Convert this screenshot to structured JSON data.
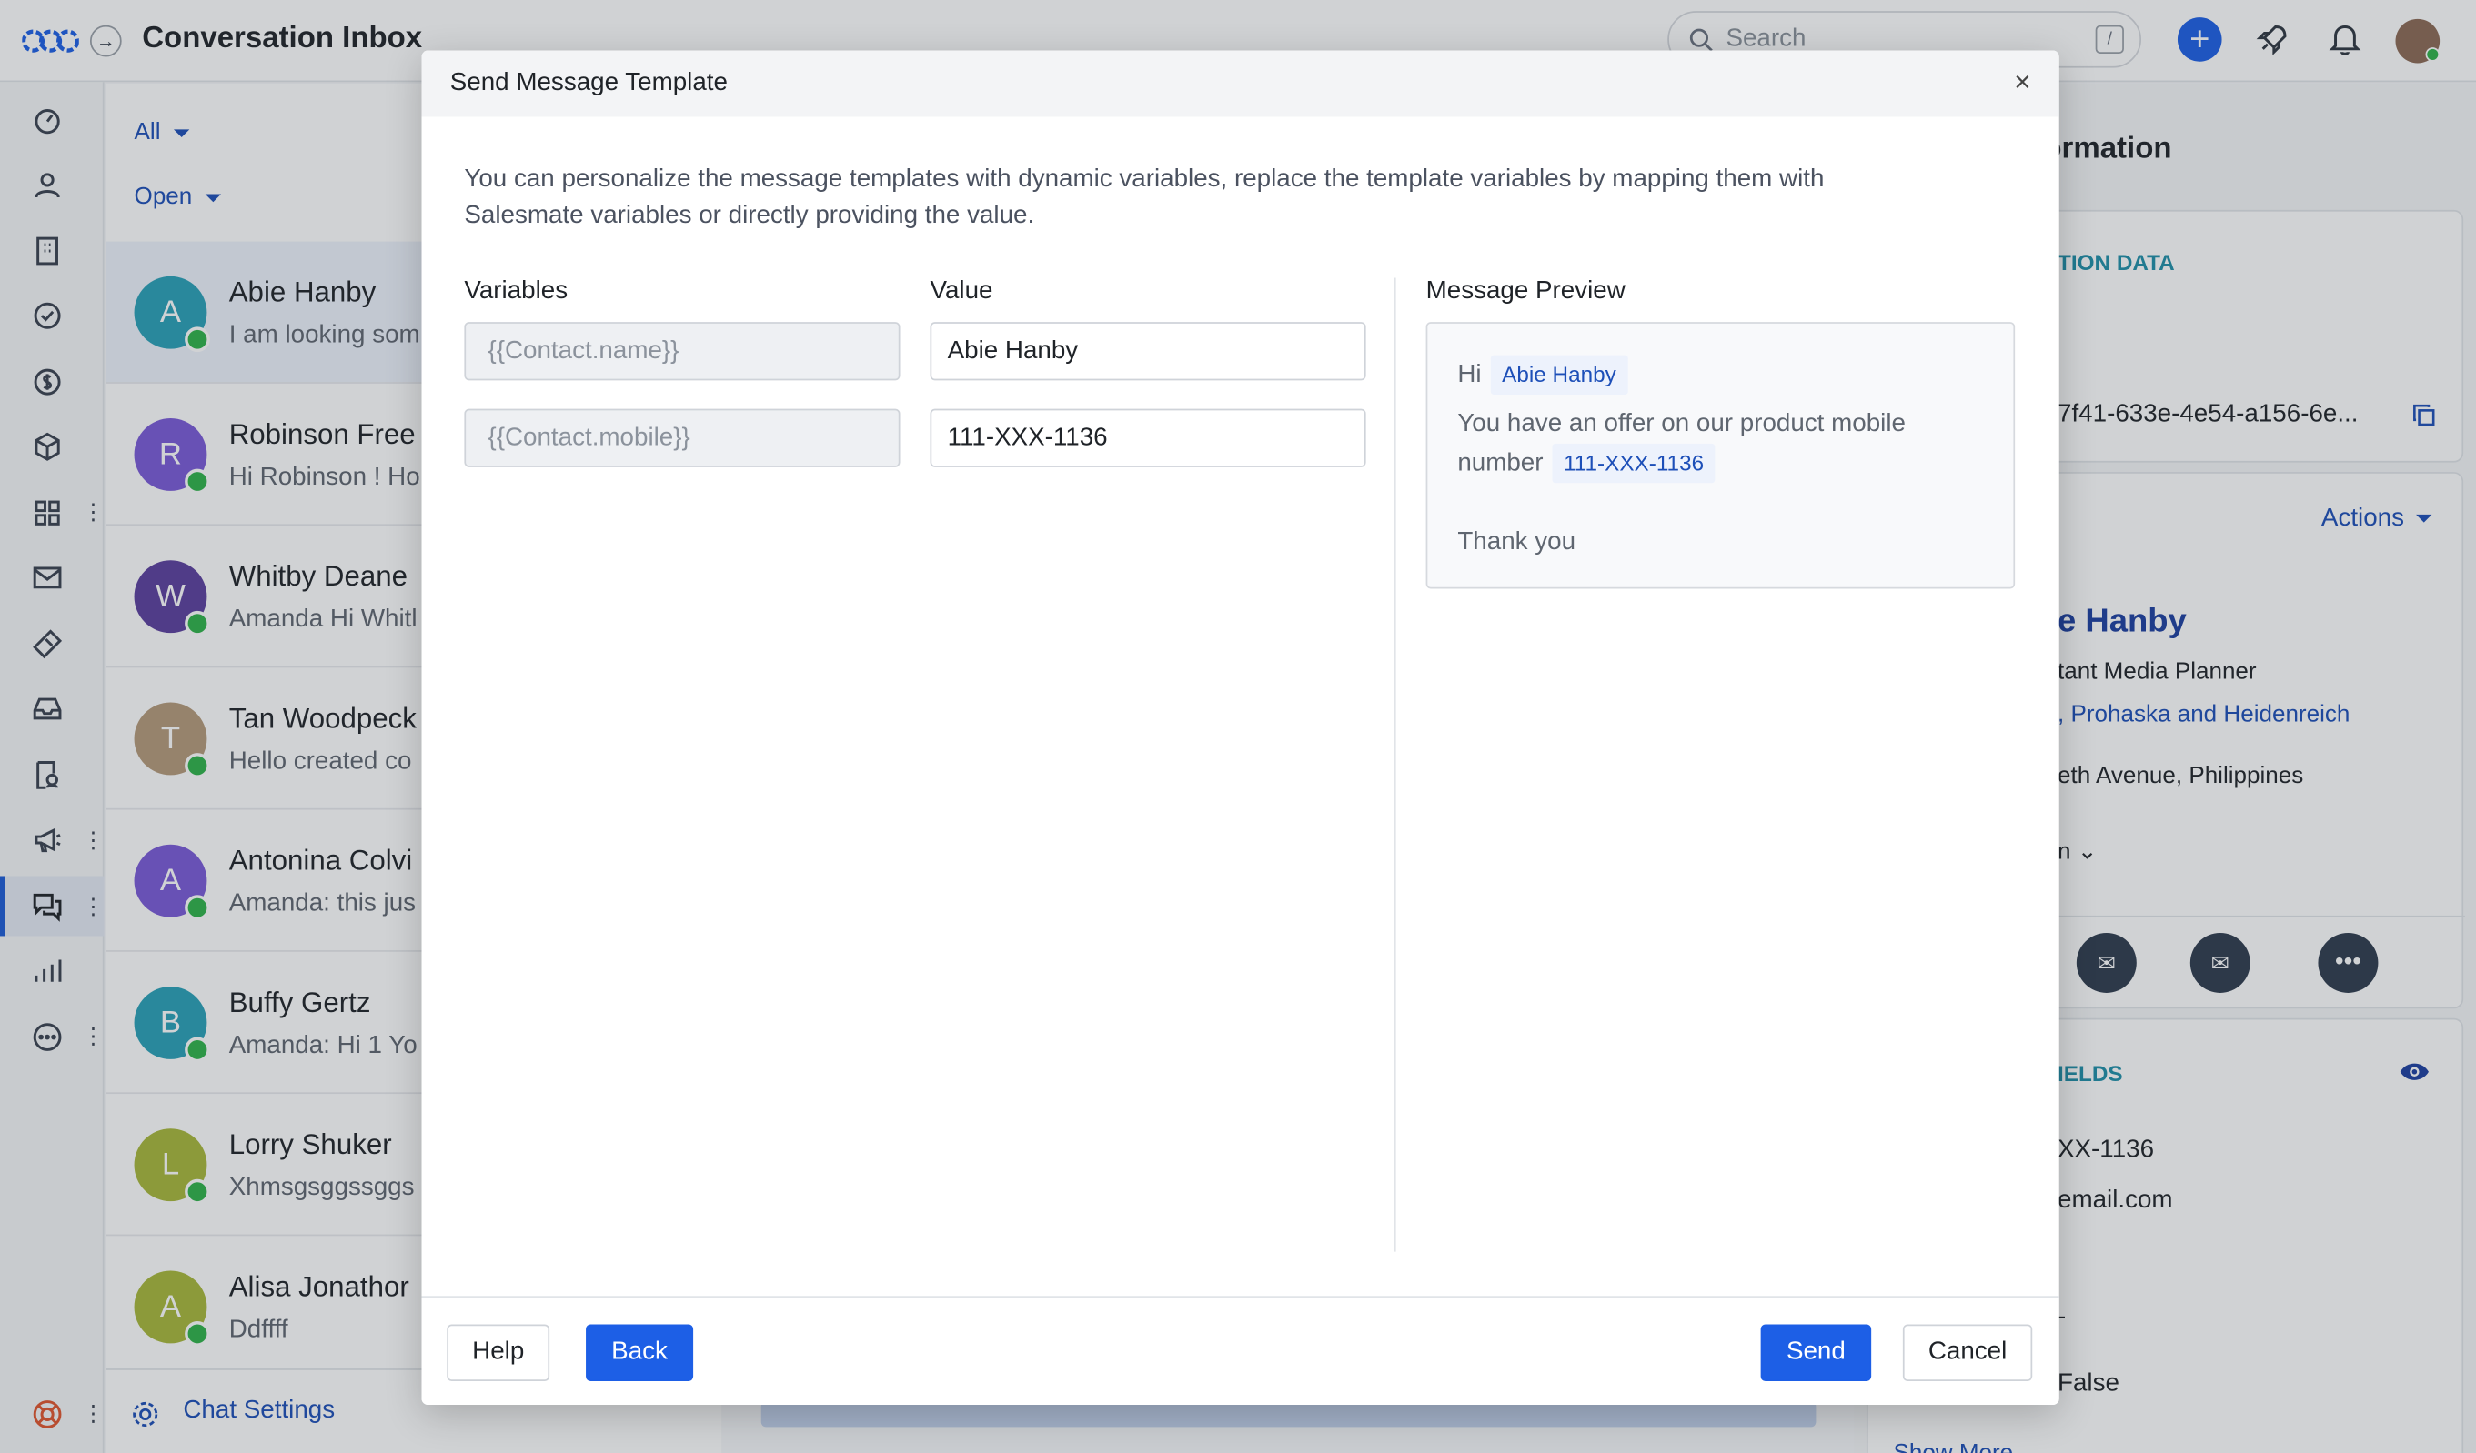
{
  "app": {
    "title": "Conversation Inbox"
  },
  "search": {
    "placeholder": "Search",
    "shortcut": "/"
  },
  "filters": {
    "view": "All",
    "status": "Open"
  },
  "conversations": [
    {
      "initial": "A",
      "name": "Abie Hanby",
      "preview": "I am looking som",
      "color": "#2aa1b8"
    },
    {
      "initial": "R",
      "name": "Robinson Free",
      "preview": "Hi Robinson ! Ho",
      "color": "#7a5ad8"
    },
    {
      "initial": "W",
      "name": "Whitby Deane",
      "preview": "Amanda Hi Whitl",
      "color": "#5b3f9e"
    },
    {
      "initial": "T",
      "name": "Tan Woodpeck",
      "preview": "Hello created co",
      "color": "#b59a7a"
    },
    {
      "initial": "A",
      "name": "Antonina Colvi",
      "preview": "Amanda: this jus",
      "color": "#7a5ad8"
    },
    {
      "initial": "B",
      "name": "Buffy Gertz",
      "preview": "Amanda: Hi 1 Yo",
      "color": "#2aa1b8"
    },
    {
      "initial": "L",
      "name": "Lorry Shuker",
      "preview": "Xhmsgsggssggs",
      "color": "#a8b83a"
    },
    {
      "initial": "A",
      "name": "Alisa Jonathor",
      "preview": "Ddffff",
      "color": "#a8b83a"
    }
  ],
  "list_footer": {
    "chat_settings": "Chat Settings"
  },
  "right_panel": {
    "header": "ormation",
    "section1": "TION DATA",
    "conversation_id": "7f41-633e-4e54-a156-6e...",
    "actions": "Actions",
    "contact_name": "e Hanby",
    "job_title": "tant Media Planner",
    "company": ", Prohaska and Heidenreich",
    "address": "eth Avenue, Philippines",
    "dropdown": "n",
    "section2": "IELDS",
    "mobile": "XX-1136",
    "email": "email.com",
    "dash": "-",
    "flag": "False",
    "show_more": "Show More"
  },
  "modal": {
    "title": "Send Message Template",
    "description": "You can personalize the message templates with dynamic variables, replace the template variables by mapping them with Salesmate variables or directly providing the value.",
    "variables_label": "Variables",
    "value_label": "Value",
    "preview_label": "Message Preview",
    "rows": [
      {
        "variable": "{{Contact.name}}",
        "value": "Abie Hanby"
      },
      {
        "variable": "{{Contact.mobile}}",
        "value": "111-XXX-1136"
      }
    ],
    "preview": {
      "greeting": "Hi",
      "name_chip": "Abie Hanby",
      "line": "You have an offer on our product mobile",
      "line2": "number",
      "mobile_chip": "111-XXX-1136",
      "closing": "Thank you"
    },
    "buttons": {
      "help": "Help",
      "back": "Back",
      "send": "Send",
      "cancel": "Cancel"
    }
  },
  "colors": {
    "primary": "#1d5fe6",
    "link": "#1d4fb8",
    "whatsapp": "#2fb34a"
  }
}
